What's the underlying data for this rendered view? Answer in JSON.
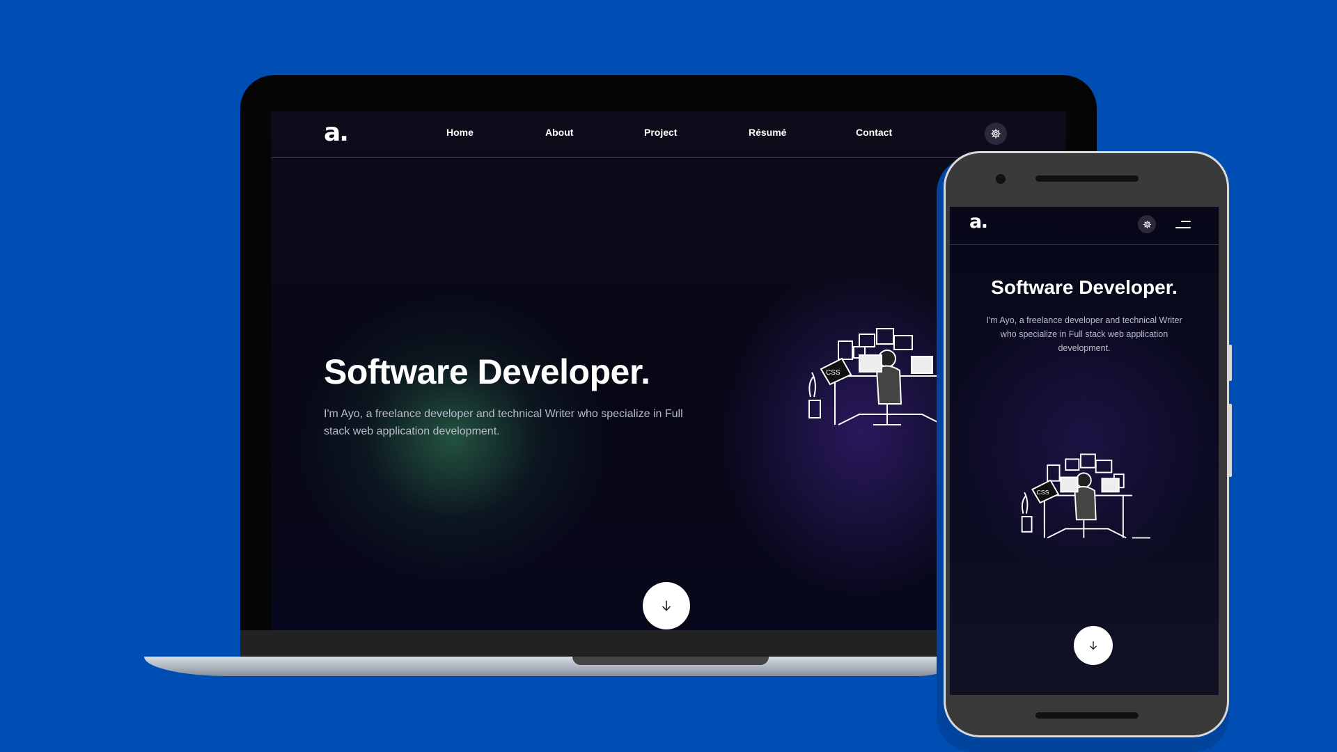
{
  "brand": {
    "logo_text": "a."
  },
  "nav": {
    "links": [
      "Home",
      "About",
      "Project",
      "Résumé",
      "Contact"
    ]
  },
  "hero": {
    "title": "Software Developer.",
    "description": "I'm Ayo, a freelance developer and technical Writer who specialize in Full stack web application development."
  },
  "icons": {
    "settings": "gear-icon",
    "menu": "hamburger-menu-icon",
    "scroll": "arrow-down-icon"
  },
  "colors": {
    "background": "#004db3",
    "screen_bg": "#08081a",
    "accent_green_glow": "#285f46",
    "accent_purple_glow": "#46288f"
  }
}
